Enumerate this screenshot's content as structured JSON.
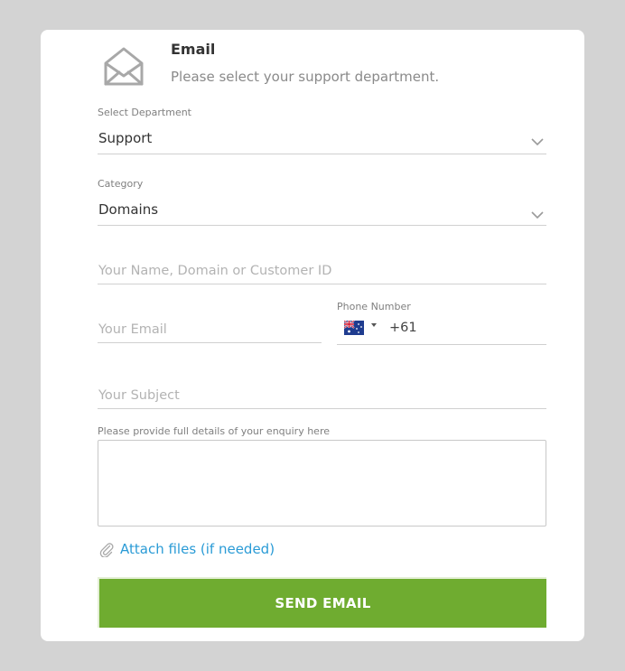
{
  "header": {
    "title": "Email",
    "subtitle": "Please select your support department.",
    "icon": "envelope-open-icon"
  },
  "department": {
    "label": "Select Department",
    "value": "Support"
  },
  "category": {
    "label": "Category",
    "value": "Domains"
  },
  "name_field": {
    "placeholder": "Your Name, Domain or Customer ID",
    "value": ""
  },
  "email_field": {
    "placeholder": "Your Email",
    "value": ""
  },
  "phone": {
    "label": "Phone Number",
    "country_flag": "australia-flag-icon",
    "value": "+61"
  },
  "subject_field": {
    "placeholder": "Your Subject",
    "value": ""
  },
  "details": {
    "label": "Please provide full details of your enquiry here",
    "value": ""
  },
  "attach": {
    "label": "Attach files (if needed)",
    "icon": "paperclip-icon"
  },
  "send_button": {
    "label": "SEND EMAIL"
  },
  "colors": {
    "accent_green": "#6fac30",
    "link_blue": "#2a9bd6",
    "background": "#d3d3d3"
  }
}
